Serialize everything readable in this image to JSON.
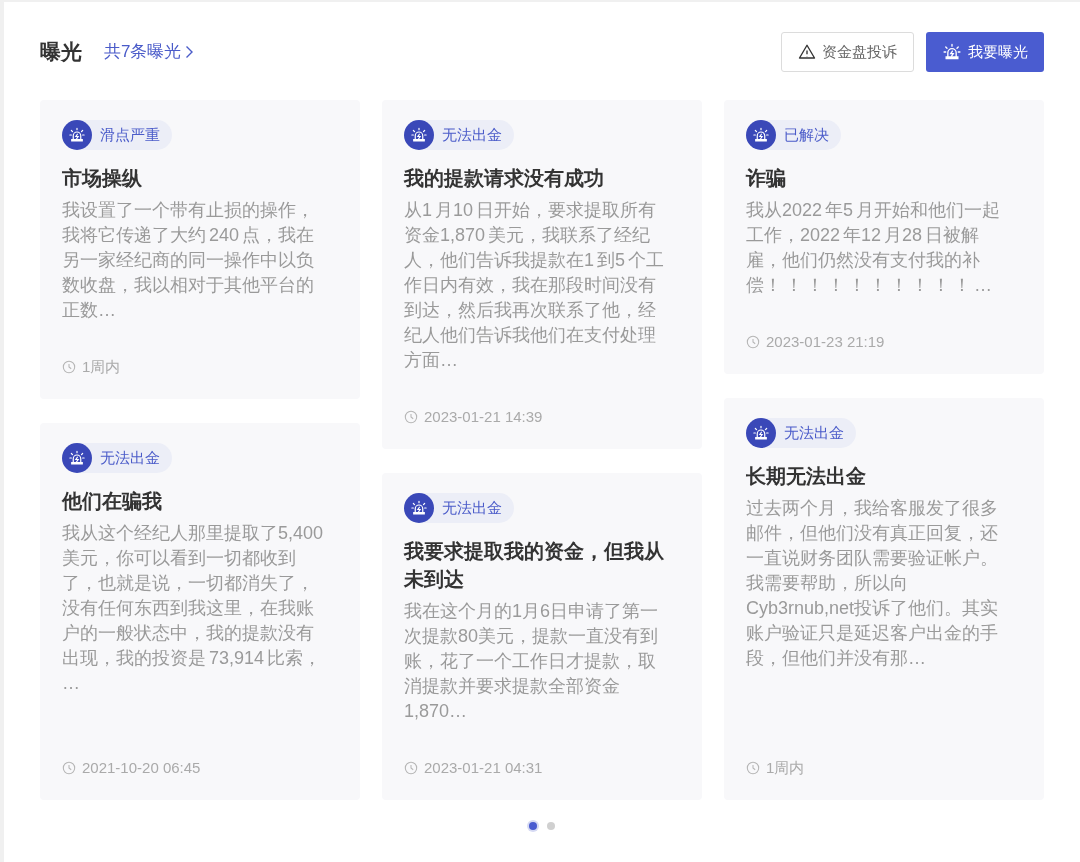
{
  "header": {
    "title": "曝光",
    "link": "共7条曝光"
  },
  "buttons": [
    {
      "kind": "outline",
      "label": "资金盘投诉"
    },
    {
      "kind": "primary",
      "label": "我要曝光"
    }
  ],
  "columns": [
    {
      "cards": [
        {
          "tag": "滑点严重",
          "title": "市场操纵",
          "body": "我设置了一个带有止损的操作，我将它传递了大约 240 点，我在另一家经纪商的同一操作中以负数收盘，我以相对于其他平台的正数…",
          "time": "1周内"
        },
        {
          "tag": "无法出金",
          "title": "他们在骗我",
          "body": "我从这个经纪人那里提取了5,400 美元，你可以看到一切都收到了，也就是说，一切都消失了，没有任何东西到我这里，在我账户的一般状态中，我的提款没有出现，我的投资是 73,914 比索， …",
          "time": "2021-10-20 06:45"
        }
      ]
    },
    {
      "cards": [
        {
          "tag": "无法出金",
          "title": "我的提款请求没有成功",
          "body": "从1 月10 日开始，要求提取所有资金1,870 美元，我联系了经纪人，他们告诉我提款在1 到5 个工作日内有效，我在那段时间没有到达，然后我再次联系了他，经纪人他们告诉我他们在支付处理方面…",
          "time": "2023-01-21 14:39"
        },
        {
          "tag": "无法出金",
          "title": "我要求提取我的资金，但我从未到达",
          "body": "我在这个月的1月6日申请了第一次提款80美元，提款一直没有到账，花了一个工作日才提款，取消提款并要求提款全部资金1,870…",
          "time": "2023-01-21 04:31"
        }
      ]
    },
    {
      "cards": [
        {
          "tag": "已解决",
          "title": "诈骗",
          "body": "我从2022 年5 月开始和他们一起工作，2022 年12 月28 日被解雇，他们仍然没有支付我的补偿！ ！ ！ ！ ！ ！ ！ ！ ！ ！ …",
          "time": "2023-01-23 21:19"
        },
        {
          "tag": "无法出金",
          "title": "长期无法出金",
          "body": "过去两个月，我给客服发了很多邮件，但他们没有真正回复，还一直说财务团队需要验证帐户。我需要帮助，所以向Cyb3rnub,net投诉了他们。其实账户验证只是延迟客户出金的手段，但他们并没有那…",
          "time": "1周内"
        }
      ]
    }
  ],
  "pagination": [
    {
      "selected": true
    },
    {
      "selected": false
    }
  ]
}
